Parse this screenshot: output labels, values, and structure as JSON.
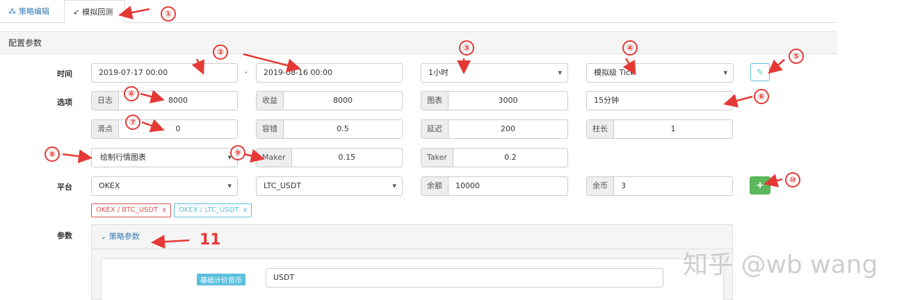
{
  "tabs": [
    {
      "label": "策略编辑",
      "icon": "cubes-icon"
    },
    {
      "label": "模拟回测",
      "icon": "rocket-icon"
    }
  ],
  "section_title": "配置参数",
  "labels": {
    "time": "时间",
    "options": "选项",
    "platform": "平台",
    "params": "参数"
  },
  "time": {
    "start": "2019-07-17 00:00",
    "separator": "-",
    "end": "2019-08-16 00:00",
    "period": "1小时",
    "mode": "模拟级 Tick"
  },
  "options": {
    "log": {
      "label": "日志",
      "value": "8000"
    },
    "profit": {
      "label": "收益",
      "value": "8000"
    },
    "chart": {
      "label": "图表",
      "value": "3000"
    },
    "period2": "15分钟",
    "slippage": {
      "label": "滑点",
      "value": "0"
    },
    "tolerance": {
      "label": "容错",
      "value": "0.5"
    },
    "delay": {
      "label": "延迟",
      "value": "200"
    },
    "bar_len": {
      "label": "柱长",
      "value": "1"
    },
    "draw_chart": "绘制行情图表",
    "maker": {
      "label": "Maker",
      "value": "0.15"
    },
    "taker": {
      "label": "Taker",
      "value": "0.2"
    }
  },
  "platform": {
    "exchange": "OKEX",
    "pair": "LTC_USDT",
    "balance": {
      "label": "余额",
      "value": "10000"
    },
    "coins": {
      "label": "余币",
      "value": "3"
    },
    "add_label": "+",
    "tags": [
      {
        "label": "OKEX / BTC_USDT",
        "remove": "x"
      },
      {
        "label": "OKEX / LTC_USDT",
        "remove": "x"
      }
    ]
  },
  "params_panel": {
    "title": "策略参数",
    "param_label": "基础计价货币",
    "param_value": "USDT"
  },
  "annotations": [
    "①",
    "②",
    "③",
    "④",
    "⑤",
    "⑥",
    "⑥",
    "⑦",
    "⑧",
    "⑨",
    "⑩",
    "11"
  ],
  "watermark": "知乎 @wb wang",
  "colors": {
    "accent": "#337ab7",
    "info": "#5bc0de",
    "success": "#5cb85c",
    "danger": "#d9534f",
    "annotation": "#e53935"
  }
}
